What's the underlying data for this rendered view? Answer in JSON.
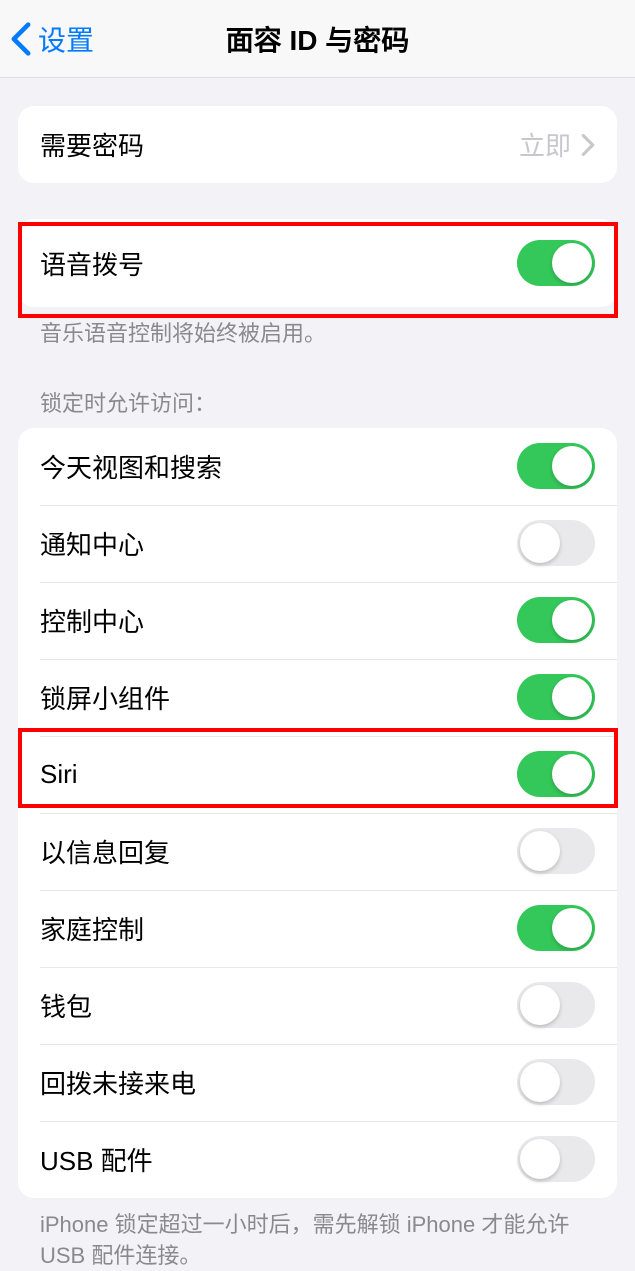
{
  "nav": {
    "back_label": "设置",
    "title": "面容 ID 与密码"
  },
  "require_passcode": {
    "label": "需要密码",
    "value": "立即"
  },
  "voice_dial": {
    "label": "语音拨号",
    "footer": "音乐语音控制将始终被启用。",
    "on": true
  },
  "lock_access": {
    "header": "锁定时允许访问：",
    "items": [
      {
        "label": "今天视图和搜索",
        "on": true
      },
      {
        "label": "通知中心",
        "on": false
      },
      {
        "label": "控制中心",
        "on": true
      },
      {
        "label": "锁屏小组件",
        "on": true
      },
      {
        "label": "Siri",
        "on": true
      },
      {
        "label": "以信息回复",
        "on": false
      },
      {
        "label": "家庭控制",
        "on": true
      },
      {
        "label": "钱包",
        "on": false
      },
      {
        "label": "回拨未接来电",
        "on": false
      },
      {
        "label": "USB 配件",
        "on": false
      }
    ],
    "footer": "iPhone 锁定超过一小时后，需先解锁 iPhone 才能允许 USB 配件连接。"
  }
}
